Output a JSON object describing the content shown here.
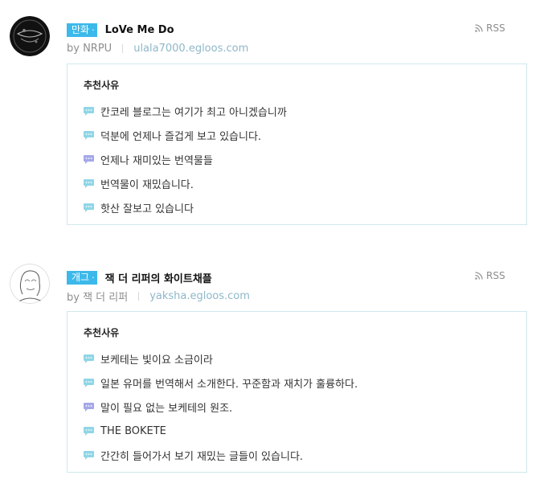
{
  "entries": [
    {
      "category": "만화",
      "title": "LoVe Me Do",
      "rss_label": "RSS",
      "author": "by NRPU",
      "url": "ulala7000.egloos.com",
      "avatar_icon": "dark-logo-avatar",
      "reason_title": "추천사유",
      "reasons": [
        {
          "text": "칸코레 블로그는 여기가 최고 아니겠습니까",
          "icon_color": "#8fd6e6"
        },
        {
          "text": "덕분에 언제나 즐겁게 보고 있습니다.",
          "icon_color": "#8fd6e6"
        },
        {
          "text": "언제나 재미있는 번역물들",
          "icon_color": "#a4a8e8"
        },
        {
          "text": "번역물이 재밌습니다.",
          "icon_color": "#8fd6e6"
        },
        {
          "text": "핫산 잘보고 있습니다",
          "icon_color": "#8fd6e6"
        }
      ]
    },
    {
      "category": "개그",
      "title": "잭 더 리퍼의 화이트채플",
      "rss_label": "RSS",
      "author": "by 잭 더 리퍼",
      "url": "yaksha.egloos.com",
      "avatar_icon": "line-drawing-face-avatar",
      "reason_title": "추천사유",
      "reasons": [
        {
          "text": "보케테는 빛이요 소금이라",
          "icon_color": "#8fd6e6"
        },
        {
          "text": "일본 유머를 번역해서 소개한다. 꾸준함과 재치가 훌륭하다.",
          "icon_color": "#8fd6e6"
        },
        {
          "text": "말이 필요 없는 보케테의 원조.",
          "icon_color": "#a4a8e8"
        },
        {
          "text": "THE BOKETE",
          "icon_color": "#8fd6e6"
        },
        {
          "text": "간간히 들어가서 보기 재밌는 글들이 있습니다.",
          "icon_color": "#8fd6e6"
        }
      ]
    }
  ],
  "colors": {
    "badge": "#3cb9ea",
    "box_border": "#cfe8ee",
    "url": "#8fb7c9"
  }
}
